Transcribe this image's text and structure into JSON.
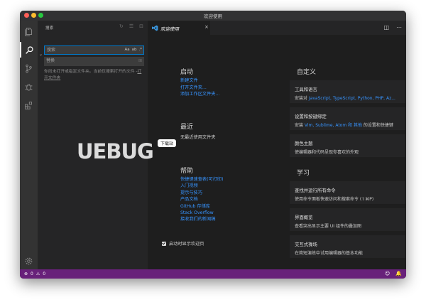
{
  "window": {
    "title": "欢迎使用"
  },
  "sidebar": {
    "title": "搜索",
    "search": {
      "placeholder": "搜索",
      "options": [
        "Aa",
        "ab",
        ".*"
      ]
    },
    "replace": {
      "placeholder": "替换"
    },
    "message": "你尚未打开或指定文件夹。当前仅搜索打开的文件 -",
    "message_link": "打开文件夹"
  },
  "editor": {
    "tab": {
      "label": "欢迎使用",
      "close": "×"
    },
    "start": {
      "heading": "启动",
      "links": [
        "新建文件",
        "打开文件夹...",
        "添加工作区文件夹..."
      ]
    },
    "recent": {
      "heading": "最近",
      "empty": "无最近使用文件夹"
    },
    "help": {
      "heading": "帮助",
      "links": [
        "快捷键速查表(可打印)",
        "入门视频",
        "提示与技巧",
        "产品文档",
        "GitHub 存储库",
        "Stack Overflow",
        "接收我们的新闻稿"
      ]
    },
    "customize": {
      "heading": "自定义",
      "cards": [
        {
          "title": "工具和语言",
          "desc_prefix": "安装对 ",
          "highlight": "JavaScript, TypeScript, Python, PHP, Az...",
          "desc_suffix": ""
        },
        {
          "title": "设置和按键绑定",
          "desc_prefix": "安装 ",
          "highlight": "Vim, Sublime, Atom 和 其他",
          "desc_suffix": " 的设置和快捷键"
        },
        {
          "title": "颜色主题",
          "desc_prefix": "",
          "highlight": "",
          "desc_suffix": "使编辑器和代码呈现你喜欢的外观"
        }
      ]
    },
    "learn": {
      "heading": "学习",
      "cards": [
        {
          "title": "查找并运行所有命令",
          "desc": "使用命令面板快速访问和搜索命令 (⇧⌘P)"
        },
        {
          "title": "界面概览",
          "desc": "查看突出显示主要 UI 组件的叠加图"
        },
        {
          "title": "交互式操场",
          "desc": "在简短演练中试用编辑器的基本功能"
        }
      ]
    },
    "startup_checkbox": "启动时显示欢迎页"
  },
  "statusbar": {
    "errors": "0",
    "warnings": "0"
  },
  "watermark": {
    "text": "UEBUG",
    "badge": "下载站"
  },
  "colors": {
    "accent": "#007acc",
    "statusbar": "#68217a",
    "link": "#3794ff"
  }
}
